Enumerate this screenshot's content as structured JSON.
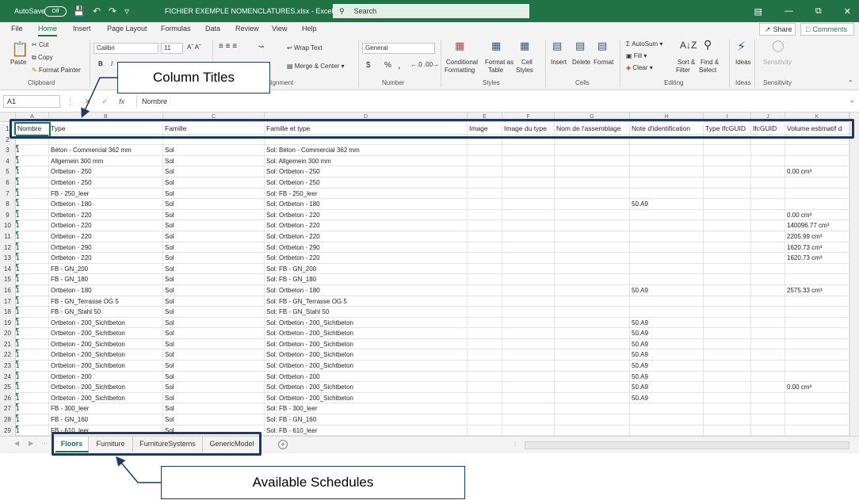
{
  "titlebar": {
    "autosave_label": "AutoSave",
    "autosave_state": "Off",
    "document_title": "FICHIER EXEMPLE NOMENCLATURES.xlsx  -  Excel",
    "search_placeholder": "Search",
    "brand_color": "#217346"
  },
  "menu": {
    "tabs": [
      "File",
      "Home",
      "Insert",
      "Page Layout",
      "Formulas",
      "Data",
      "Review",
      "View",
      "Help"
    ],
    "active_tab": "Home",
    "share_label": "Share",
    "comments_label": "Comments"
  },
  "ribbon": {
    "clipboard": {
      "paste": "Paste",
      "cut": "Cut",
      "copy": "Copy",
      "format_painter": "Format Painter",
      "group": "Clipboard"
    },
    "font": {
      "name": "Calibri",
      "size": "11",
      "bold": "B",
      "italic": "I"
    },
    "alignment": {
      "wrap_text": "Wrap Text",
      "merge_center": "Merge & Center",
      "group": "lignment"
    },
    "number": {
      "format": "General",
      "currency": "$",
      "percent": "%",
      "comma": ",",
      "group": "Number"
    },
    "styles": {
      "conditional": "Conditional",
      "conditional2": "Formatting",
      "format_as": "Format as",
      "format_as2": "Table",
      "cell": "Cell",
      "cell2": "Styles",
      "group": "Styles"
    },
    "cells": {
      "insert": "Insert",
      "delete": "Delete",
      "format": "Format",
      "group": "Cells"
    },
    "editing": {
      "autosum": "AutoSum",
      "fill": "Fill",
      "clear": "Clear",
      "sort": "Sort &",
      "sort2": "Filter",
      "find": "Find &",
      "find2": "Select",
      "group": "Editing"
    },
    "ideas": {
      "label": "Ideas",
      "group": "Ideas"
    },
    "sensitivity": {
      "label": "Sensitivity",
      "group": "Sensitivity"
    }
  },
  "formula_bar": {
    "name_box": "A1",
    "fx": "fx",
    "content": "Nombre"
  },
  "grid": {
    "column_letters": [
      "A",
      "B",
      "C",
      "D",
      "E",
      "F",
      "G",
      "H",
      "I",
      "J",
      "K"
    ],
    "row_numbers": [
      "1",
      "2",
      "3",
      "4",
      "5",
      "6",
      "7",
      "8",
      "9",
      "10",
      "11",
      "12",
      "13",
      "14",
      "15",
      "16",
      "17",
      "18",
      "19",
      "20",
      "21",
      "22",
      "23",
      "24",
      "25",
      "26",
      "27",
      "28",
      "29"
    ],
    "headers": [
      "Nombre",
      "Type",
      "Famille",
      "Famille et type",
      "Image",
      "Image du type",
      "Nom de l'assemblage",
      "Note d'identification",
      "Type IfcGUID",
      "IfcGUID",
      "Volume estimatif d"
    ],
    "rows": [
      [
        "",
        "",
        "",
        "",
        "",
        "",
        "",
        "",
        "",
        "",
        ""
      ],
      [
        "1",
        "Béton - Commercial 362 mm",
        "Sol",
        "Sol: Béton - Commercial 362 mm",
        "",
        "",
        "",
        "",
        "",
        "",
        ""
      ],
      [
        "1",
        "Allgemein 300 mm",
        "Sol",
        "Sol: Allgemein 300 mm",
        "",
        "",
        "",
        "",
        "",
        "",
        ""
      ],
      [
        "1",
        "Ortbeton - 250",
        "Sol",
        "Sol: Ortbeton - 250",
        "",
        "",
        "",
        "",
        "",
        "",
        "0.00 cm³"
      ],
      [
        "1",
        "Ortbeton - 250",
        "Sol",
        "Sol: Ortbeton - 250",
        "",
        "",
        "",
        "",
        "",
        "",
        ""
      ],
      [
        "1",
        "FB - 250_leer",
        "Sol",
        "Sol: FB - 250_leer",
        "",
        "",
        "",
        "",
        "",
        "",
        ""
      ],
      [
        "1",
        "Ortbeton - 180",
        "Sol",
        "Sol: Ortbeton - 180",
        "",
        "",
        "",
        "50.A9",
        "",
        "",
        ""
      ],
      [
        "1",
        "Ortbeton - 220",
        "Sol",
        "Sol: Ortbeton - 220",
        "",
        "",
        "",
        "",
        "",
        "",
        "0.00 cm³"
      ],
      [
        "1",
        "Ortbeton - 220",
        "Sol",
        "Sol: Ortbeton - 220",
        "",
        "",
        "",
        "",
        "",
        "",
        "140096.77 cm³"
      ],
      [
        "1",
        "Ortbeton - 220",
        "Sol",
        "Sol: Ortbeton - 220",
        "",
        "",
        "",
        "",
        "",
        "",
        "2205.99 cm³"
      ],
      [
        "1",
        "Ortbeton - 290",
        "Sol",
        "Sol: Ortbeton - 290",
        "",
        "",
        "",
        "",
        "",
        "",
        "1620.73 cm³"
      ],
      [
        "1",
        "Ortbeton - 220",
        "Sol",
        "Sol: Ortbeton - 220",
        "",
        "",
        "",
        "",
        "",
        "",
        "1620.73 cm³"
      ],
      [
        "1",
        "FB - GN_200",
        "Sol",
        "Sol: FB - GN_200",
        "",
        "",
        "",
        "",
        "",
        "",
        ""
      ],
      [
        "1",
        "FB - GN_180",
        "Sol",
        "Sol: FB - GN_180",
        "",
        "",
        "",
        "",
        "",
        "",
        ""
      ],
      [
        "1",
        "Ortbeton - 180",
        "Sol",
        "Sol: Ortbeton - 180",
        "",
        "",
        "",
        "50.A9",
        "",
        "",
        "2575.33 cm³"
      ],
      [
        "1",
        "FB - GN_Terrasse OG 5",
        "Sol",
        "Sol: FB - GN_Terrasse OG 5",
        "",
        "",
        "",
        "",
        "",
        "",
        ""
      ],
      [
        "1",
        "FB - GN_Stahl 50",
        "Sol",
        "Sol: FB - GN_Stahl 50",
        "",
        "",
        "",
        "",
        "",
        "",
        ""
      ],
      [
        "1",
        "Ortbeton - 200_Sichtbeton",
        "Sol",
        "Sol: Ortbeton - 200_Sichtbeton",
        "",
        "",
        "",
        "50.A9",
        "",
        "",
        ""
      ],
      [
        "1",
        "Ortbeton - 200_Sichtbeton",
        "Sol",
        "Sol: Ortbeton - 200_Sichtbeton",
        "",
        "",
        "",
        "50.A9",
        "",
        "",
        ""
      ],
      [
        "1",
        "Ortbeton - 200_Sichtbeton",
        "Sol",
        "Sol: Ortbeton - 200_Sichtbeton",
        "",
        "",
        "",
        "50.A9",
        "",
        "",
        ""
      ],
      [
        "1",
        "Ortbeton - 200_Sichtbeton",
        "Sol",
        "Sol: Ortbeton - 200_Sichtbeton",
        "",
        "",
        "",
        "50.A9",
        "",
        "",
        ""
      ],
      [
        "1",
        "Ortbeton - 200_Sichtbeton",
        "Sol",
        "Sol: Ortbeton - 200_Sichtbeton",
        "",
        "",
        "",
        "50.A9",
        "",
        "",
        ""
      ],
      [
        "1",
        "Ortbeton - 200",
        "Sol",
        "Sol: Ortbeton - 200",
        "",
        "",
        "",
        "50.A9",
        "",
        "",
        ""
      ],
      [
        "1",
        "Ortbeton - 200_Sichtbeton",
        "Sol",
        "Sol: Ortbeton - 200_Sichtbeton",
        "",
        "",
        "",
        "50.A9",
        "",
        "",
        "0.00 cm³"
      ],
      [
        "1",
        "Ortbeton - 200_Sichtbeton",
        "Sol",
        "Sol: Ortbeton - 200_Sichtbeton",
        "",
        "",
        "",
        "50.A9",
        "",
        "",
        ""
      ],
      [
        "1",
        "FB - 300_leer",
        "Sol",
        "Sol: FB - 300_leer",
        "",
        "",
        "",
        "",
        "",
        "",
        ""
      ],
      [
        "1",
        "FB - GN_160",
        "Sol",
        "Sol: FB - GN_160",
        "",
        "",
        "",
        "",
        "",
        "",
        ""
      ],
      [
        "1",
        "FB - 610_leer",
        "Sol",
        "Sol: FB - 610_leer",
        "",
        "",
        "",
        "",
        "",
        "",
        ""
      ]
    ]
  },
  "sheet_tabs": {
    "tabs": [
      "Floors",
      "Furniture",
      "FurnitureSystems",
      "GenericModel"
    ],
    "active": "Floors"
  },
  "annotations": {
    "column_titles": "Column Titles",
    "available_schedules": "Available Schedules",
    "callout_color": "#1f3864"
  }
}
